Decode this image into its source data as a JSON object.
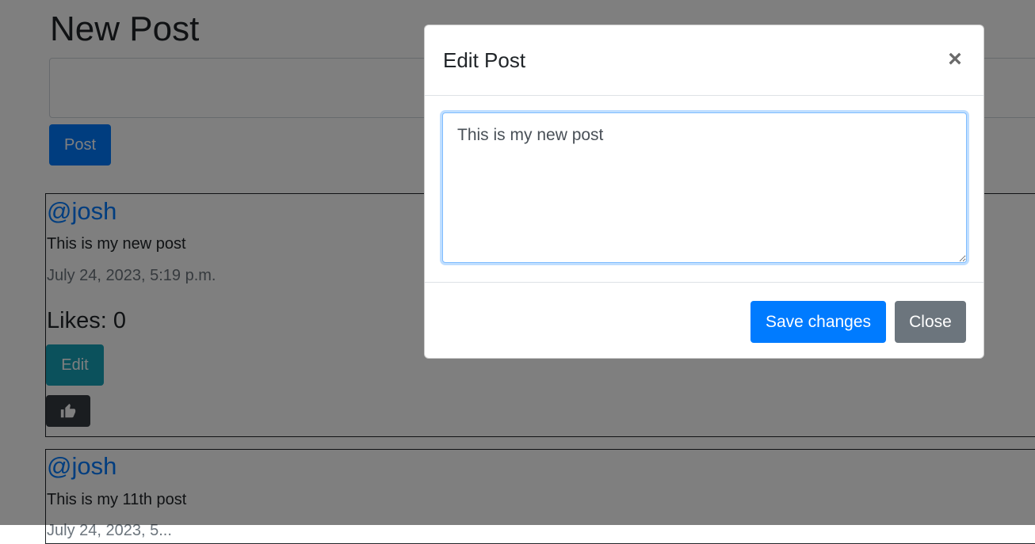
{
  "page": {
    "title": "New Post",
    "post_button_label": "Post"
  },
  "posts": [
    {
      "username": "@josh",
      "content": "This is my new post",
      "timestamp": "July 24, 2023, 5:19 p.m.",
      "likes_text": "Likes: 0",
      "edit_label": "Edit",
      "like_icon": "thumbs-up-icon"
    },
    {
      "username": "@josh",
      "content": "This is my 11th post",
      "timestamp": "July 24, 2023, 5..."
    }
  ],
  "modal": {
    "title": "Edit Post",
    "close_symbol": "×",
    "textarea_value": "This is my new post",
    "save_label": "Save changes",
    "close_label": "Close"
  },
  "colors": {
    "primary": "#007bff",
    "info": "#17a2b8",
    "dark": "#343a40",
    "secondary": "#6c757d",
    "backdrop": "rgba(0,0,0,0.5)"
  }
}
